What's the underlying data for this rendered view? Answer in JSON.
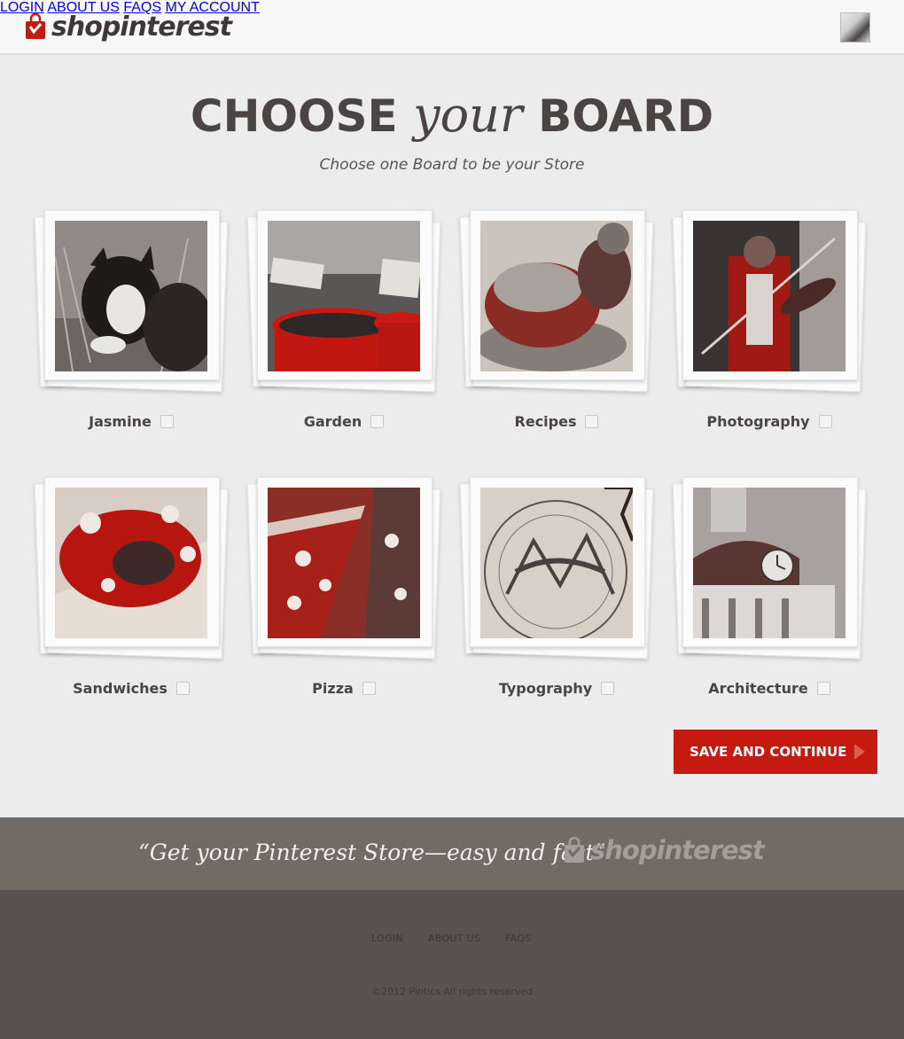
{
  "header": {
    "logo_text": "shopinterest",
    "nav": [
      "LOGIN",
      "ABOUT US",
      "FAQS",
      "MY ACCOUNT"
    ]
  },
  "main": {
    "title_part1": "CHOOSE",
    "title_part2": "your",
    "title_part3": "BOARD",
    "subtitle": "Choose one Board to be your Store",
    "boards": [
      {
        "label": "Jasmine",
        "checked": false
      },
      {
        "label": "Garden",
        "checked": false
      },
      {
        "label": "Recipes",
        "checked": false
      },
      {
        "label": "Photography",
        "checked": false
      },
      {
        "label": "Sandwiches",
        "checked": false
      },
      {
        "label": "Pizza",
        "checked": false
      },
      {
        "label": "Typography",
        "checked": false
      },
      {
        "label": "Architecture",
        "checked": false
      }
    ],
    "save_button": "SAVE AND CONTINUE"
  },
  "tagline": {
    "text": "“Get your Pinterest Store—easy and fast”",
    "logo_text": "shopinterest"
  },
  "footer": {
    "links": [
      "LOGIN",
      "ABOUT US",
      "FAQS"
    ],
    "copyright": "©2012 Pintics All rights reserved"
  },
  "colors": {
    "accent_red": "#c41a10",
    "text_dark": "#4b4444",
    "band_brown": "#736a64",
    "footer_dark": "#5a5050"
  }
}
